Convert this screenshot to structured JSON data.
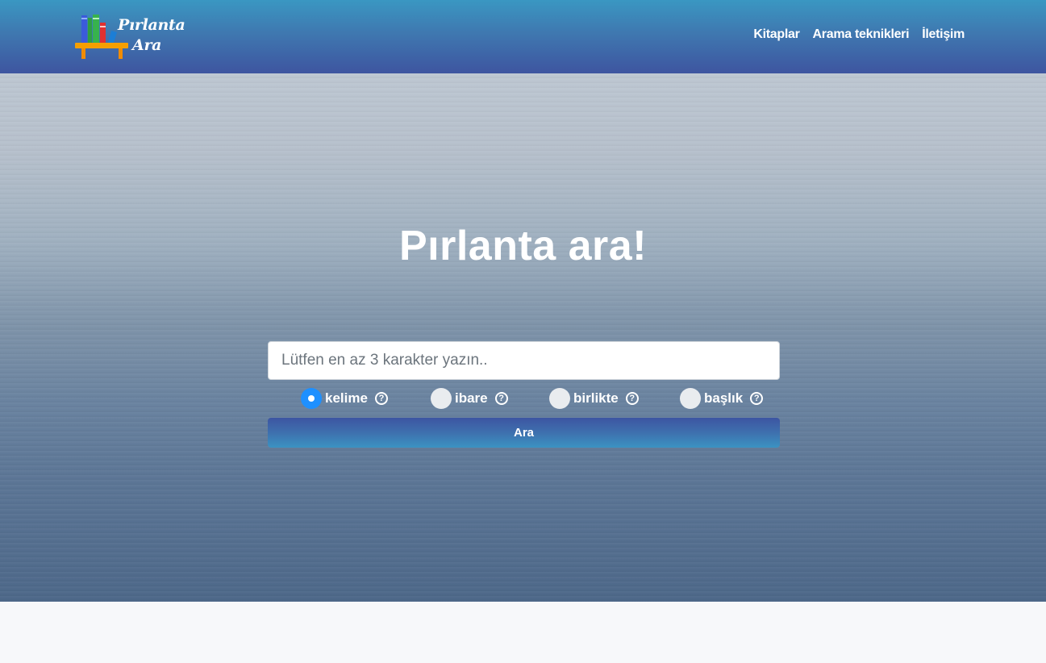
{
  "brand": {
    "line1": "Pırlanta",
    "line2": "Ara"
  },
  "nav": [
    {
      "label": "Kitaplar"
    },
    {
      "label": "Arama teknikleri"
    },
    {
      "label": "İletişim"
    }
  ],
  "hero": {
    "title": "Pırlanta ara!"
  },
  "search": {
    "placeholder": "Lütfen en az 3 karakter yazın..",
    "value": "",
    "button_label": "Ara"
  },
  "search_options": [
    {
      "label": "kelime",
      "checked": true
    },
    {
      "label": "ibare",
      "checked": false
    },
    {
      "label": "birlikte",
      "checked": false
    },
    {
      "label": "başlık",
      "checked": false
    }
  ],
  "help_glyph": "?",
  "colors": {
    "navbar_top": "#3a97c2",
    "navbar_bottom": "#3e55a0",
    "radio_checked": "#1e90ff",
    "page_background": "#f7f8fa"
  },
  "icons": [
    "bookshelf-logo-icon",
    "help-circle-icon"
  ]
}
